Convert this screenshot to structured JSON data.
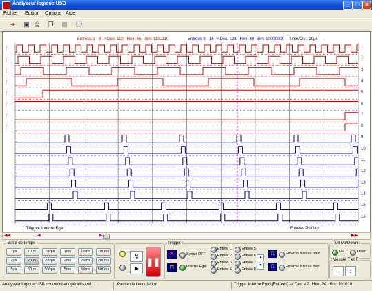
{
  "window": {
    "title": "Analyseur logique USB"
  },
  "menu": [
    "Fichier",
    "Edition",
    "Options",
    "Aide"
  ],
  "header": {
    "left": "Entrées 1 - 8 -> Dec: 110   Hex: 6E   Bin: 1101110",
    "middle": "Entrées 9 - 16 -> Dec: 128   Hex: 80   Bin: 10000000",
    "right": "Time/Div : 20µs"
  },
  "channels": [
    "1",
    "2",
    "3",
    "4",
    "5",
    "6",
    "7",
    "8",
    "9",
    "10",
    "11",
    "12",
    "13",
    "14",
    "15",
    "16"
  ],
  "colors": {
    "low_channels": "#cc0000",
    "high_channels": "#000080",
    "cursor": "#e000e0"
  },
  "scope_footer": {
    "left": "Trigger: Interne Egal",
    "right": "Entrées Pull Up"
  },
  "timebase": {
    "label": "Base de temps :",
    "buttons": [
      "1µs",
      "10µs",
      "100µs",
      "1ms",
      "10ms",
      "100ms",
      "2µs",
      "20µs",
      "200µs",
      "2ms",
      "20ms",
      "200ms",
      "5µs",
      "50µs",
      "500µs",
      "5ms",
      "50ms",
      "500ms"
    ],
    "selected": "20µs"
  },
  "trigger": {
    "label": "Trigger :",
    "synch_off": "Synch OFF",
    "interne": "Interne Egal",
    "entries": [
      "Entrée 1",
      "Entrée 2",
      "Entrée 3",
      "Entrée 4",
      "Entrée 5",
      "Entrée 6",
      "Entrée 7",
      "Entrée 8"
    ],
    "externe_haut": "Externe Niveau haut",
    "externe_bas": "Externe Niveau Bas"
  },
  "pullup": {
    "label": "Pull Up/Down :",
    "up": "UP",
    "down": "Down",
    "selected": "UP"
  },
  "mesure": {
    "label": "Mesure T et F :"
  },
  "status": {
    "connection": "Analyseur logique USB connecté et opérationnel...",
    "state": "Pause de l'acquisition",
    "trigger": "Trigger Interne Egal (Entrées) -> Dec: 42",
    "hex": "Hex: 2A",
    "bin": "Bin: 101010"
  }
}
